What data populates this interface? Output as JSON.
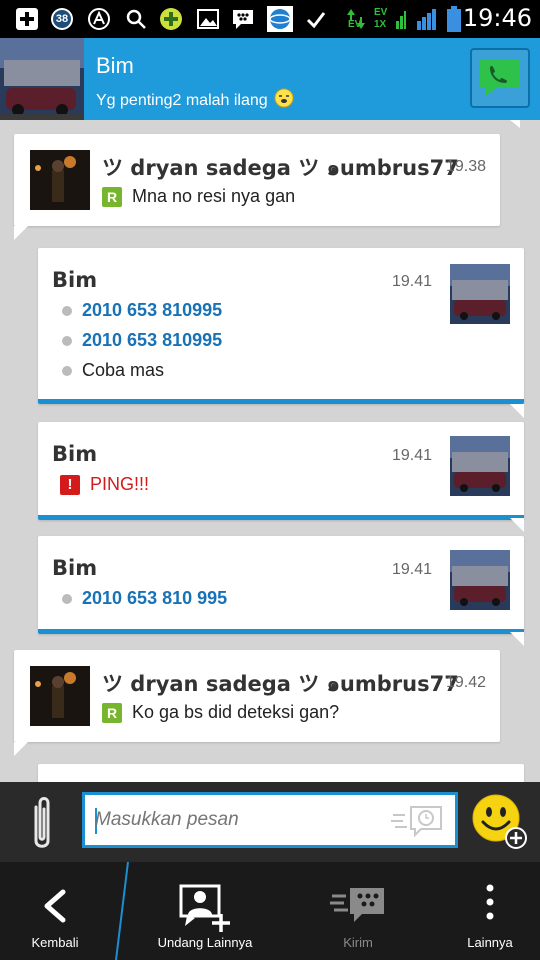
{
  "status_bar": {
    "notification_count": "38",
    "network_labels": [
      "EV",
      "EV",
      "1X"
    ],
    "time": "19:46"
  },
  "header": {
    "contact_name": "Bim",
    "status_message": "Yg penting2 malah ilang"
  },
  "messages": [
    {
      "sender": "ツ dryan sadega ツ ๑umbrus77",
      "time": "19.38",
      "badge": "R",
      "lines": [
        "Mna no resi nya gan"
      ]
    },
    {
      "sender": "Bim",
      "time": "19.41",
      "lines": [
        "2010 653 810995",
        "2010 653 810995",
        "Coba mas"
      ]
    },
    {
      "sender": "Bim",
      "time": "19.41",
      "badge": "!",
      "lines": [
        "PING!!!"
      ]
    },
    {
      "sender": "Bim",
      "time": "19.41",
      "lines": [
        "2010 653 810 995"
      ]
    },
    {
      "sender": "ツ dryan sadega ツ ๑umbrus77",
      "time": "19.42",
      "badge": "R",
      "lines": [
        "Ko ga bs did deteksi gan?"
      ]
    }
  ],
  "compose": {
    "placeholder": "Masukkan pesan"
  },
  "bottom_nav": [
    {
      "label": "Kembali",
      "icon": "back-chevron-icon"
    },
    {
      "label": "Undang Lainnya",
      "icon": "invite-contact-icon"
    },
    {
      "label": "Kirim",
      "icon": "bbm-send-icon"
    },
    {
      "label": "Lainnya",
      "icon": "overflow-menu-icon"
    }
  ],
  "colors": {
    "header_blue": "#1f9bdc",
    "link_blue": "#1972b5",
    "ping_red": "#d41b1b",
    "read_green": "#78b52e"
  }
}
